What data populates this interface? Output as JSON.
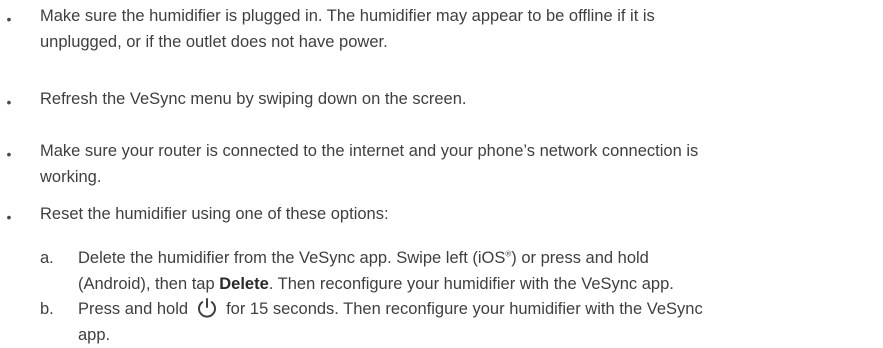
{
  "bullets": [
    {
      "marker": "•",
      "line1": "Make sure the humidifier is plugged in. The humidifier may appear to be offline if it is",
      "line2": "unplugged, or if the outlet does not have power."
    },
    {
      "marker": "•",
      "line1": "Refresh the VeSync menu by swiping down on the screen."
    },
    {
      "marker": "•",
      "line1": "Make sure your router is connected to the internet and your phone’s network connection is",
      "line2": "working."
    },
    {
      "marker": "•",
      "line1": "Reset the humidifier using one of these options:"
    }
  ],
  "options": {
    "a": {
      "marker": "a.",
      "line1_pre": "Delete the humidifier from the VeSync app. Swipe left (iOS",
      "line1_sup": "®",
      "line1_post": ") or press and hold",
      "line2_pre": "(Android), then tap ",
      "line2_bold": "Delete",
      "line2_post": ". Then reconfigure your humidifier with the VeSync app."
    },
    "b": {
      "marker": "b.",
      "line1_pre": "Press and hold",
      "icon": "power-icon",
      "line1_post": "for 15 seconds. Then reconfigure your humidifier with the VeSync",
      "line2": "app."
    }
  }
}
